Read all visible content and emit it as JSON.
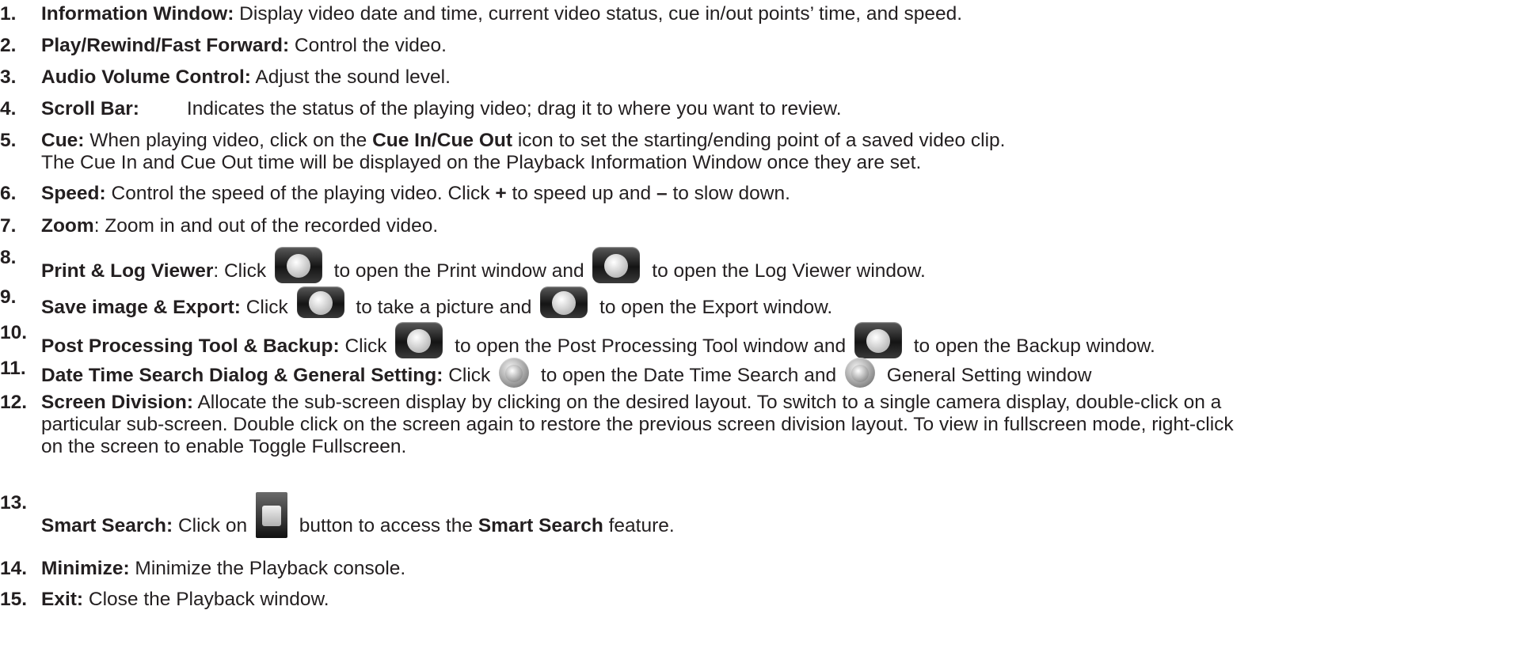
{
  "items": [
    {
      "num": "1.",
      "title": "Information Window:",
      "text": " Display video date and time, current video status, cue in/out points’ time, and speed."
    },
    {
      "num": "2.",
      "title": "Play/Rewind/Fast Forward:",
      "text": " Control the video."
    },
    {
      "num": "3.",
      "title": "Audio Volume Control:",
      "text": " Adjust the sound level."
    },
    {
      "num": "4.",
      "title": "Scroll Bar:",
      "text": "Indicates the status of the playing video; drag it to where you want to review."
    },
    {
      "num": "5.",
      "title": "Cue:",
      "text1": " When playing video, click on the ",
      "bold": "Cue In/Cue Out",
      "text2": " icon to set the starting/ending point of a saved video clip.",
      "line2": "The Cue In and Cue Out time will be displayed on the Playback Information Window once they are set."
    },
    {
      "num": "6.",
      "title": "Speed:",
      "text1": " Control the speed of the playing video. Click ",
      "plus": "+",
      "text2": " to speed up and ",
      "minus": "–",
      "text3": " to slow down."
    },
    {
      "num": "7.",
      "title": "Zoom",
      "text": ": Zoom in and out of the recorded video."
    },
    {
      "num": "8.",
      "title": "Print & Log Viewer",
      "text1": ": Click ",
      "text2": " to open the Print window and ",
      "text3": " to open the Log Viewer window."
    },
    {
      "num": "9.",
      "title": "Save image & Export:",
      "text1": " Click ",
      "text2": " to take a picture and ",
      "text3": " to open the Export window."
    },
    {
      "num": "10.",
      "title": "Post Processing Tool & Backup:",
      "text1": " Click ",
      "text2": " to open the Post Processing Tool window and ",
      "text3": " to open the Backup window."
    },
    {
      "num": "11.",
      "title": "Date Time Search Dialog & General Setting:",
      "text1": " Click ",
      "text2": " to open the Date Time Search and ",
      "text3": " General Setting window"
    },
    {
      "num": "12.",
      "title": "Screen Division:",
      "text": " Allocate the sub-screen display by clicking on the desired layout. To switch to a single camera display, double-click on a",
      "line2": "particular sub-screen. Double click on the screen again to restore the previous screen division layout. To view in fullscreen mode, right-click",
      "line3": "on the screen to enable Toggle Fullscreen."
    },
    {
      "num": "13.",
      "title": "Smart Search:",
      "text1": " Click on ",
      "text2": " button to access the ",
      "bold": "Smart Search",
      "text3": " feature."
    },
    {
      "num": "14.",
      "title": "Minimize:",
      "text": " Minimize the Playback console."
    },
    {
      "num": "15.",
      "title": "Exit:",
      "text": " Close the Playback window."
    }
  ],
  "icons": {
    "print": "printer-icon",
    "log_viewer": "log-viewer-icon",
    "save_image": "camera-snapshot-icon",
    "export": "export-icon",
    "post_processing": "post-processing-tool-icon",
    "backup": "backup-icon",
    "date_time_search": "date-time-search-icon",
    "general_setting": "wrench-icon",
    "smart_search": "binoculars-icon"
  }
}
